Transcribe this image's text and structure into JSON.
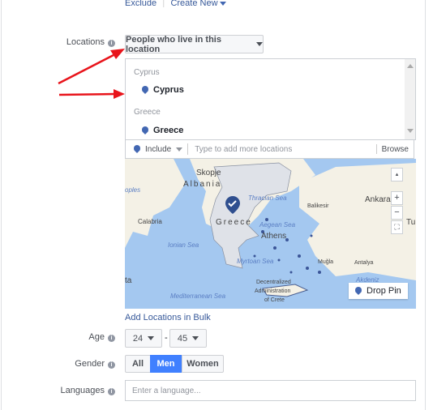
{
  "top_links": {
    "exclude": "Exclude",
    "separator": "|",
    "create_new": "Create New"
  },
  "locations": {
    "label": "Locations",
    "type_dropdown": "People who live in this location",
    "groups": [
      {
        "header": "Cyprus",
        "item": "Cyprus"
      },
      {
        "header": "Greece",
        "item": "Greece"
      }
    ],
    "include_label": "Include",
    "input_placeholder": "Type to add more locations",
    "browse": "Browse",
    "add_bulk": "Add Locations in Bulk"
  },
  "map": {
    "labels": {
      "skopje": "Skopje",
      "albania": "Albania",
      "naples": "oples",
      "calabria": "Calabria",
      "greece": "Greece",
      "thracian": "Thracian Sea",
      "aegean": "Aegean Sea",
      "athens": "Athens",
      "ionian": "Ionian Sea",
      "myrtoan": "Myrtoan Sea",
      "balikesir": "Balikesir",
      "ankara": "Ankara",
      "tu": "Tu",
      "mugla": "Muğla",
      "antalya": "Antalya",
      "akdeniz": "Akdeniz",
      "ta": "ta",
      "mediterranean": "Mediterranean Sea",
      "crete1": "Decentralized",
      "crete2": "Administration",
      "crete3": "of Crete"
    },
    "zoom_in": "+",
    "zoom_out": "−",
    "drop_pin": "Drop Pin",
    "colors": {
      "sea": "#a4c8f0",
      "land": "#f4f1e6",
      "selected": "#dfe2e8",
      "pin": "#2f4f8f"
    }
  },
  "age": {
    "label": "Age",
    "min": "24",
    "dash": "-",
    "max": "45"
  },
  "gender": {
    "label": "Gender",
    "options": [
      "All",
      "Men",
      "Women"
    ],
    "selected": "Men"
  },
  "languages": {
    "label": "Languages",
    "placeholder": "Enter a language..."
  },
  "colors": {
    "accent": "#4267b2",
    "selected_button": "#4080ff",
    "arrow": "#e8141b"
  }
}
